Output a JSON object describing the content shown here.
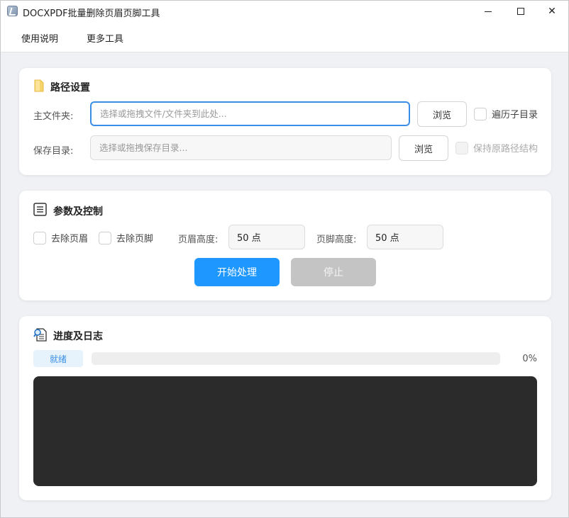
{
  "window": {
    "title": "DOCXPDF批量删除页眉页脚工具",
    "min_glyph": "",
    "close_glyph": "✕"
  },
  "menu": {
    "usage": "使用说明",
    "more_tools": "更多工具"
  },
  "path_card": {
    "title": "路径设置",
    "main_folder_label": "主文件夹:",
    "main_folder_placeholder": "选择或拖拽文件/文件夹到此处...",
    "main_folder_value": "",
    "browse_label_1": "浏览",
    "traverse_label": "遍历子目录",
    "save_dir_label": "保存目录:",
    "save_dir_placeholder": "选择或拖拽保存目录...",
    "save_dir_value": "",
    "browse_label_2": "浏览",
    "keep_structure_label": "保持原路径结构"
  },
  "params_card": {
    "title": "参数及控制",
    "remove_header_label": "去除页眉",
    "remove_footer_label": "去除页脚",
    "header_height_label": "页眉高度:",
    "header_height_value": "50 点",
    "footer_height_label": "页脚高度:",
    "footer_height_value": "50 点",
    "start_label": "开始处理",
    "stop_label": "停止"
  },
  "progress_card": {
    "title": "进度及日志",
    "status": "就绪",
    "progress": 0,
    "progress_text": "0%"
  },
  "colors": {
    "accent": "#1e97ff",
    "focus_border": "#3a8ee6",
    "log_bg": "#2b2b2b",
    "disabled_btn": "#c4c4c4"
  },
  "icons": {
    "folder": "folder-icon",
    "list": "list-icon",
    "log": "magnifier-document-icon"
  }
}
